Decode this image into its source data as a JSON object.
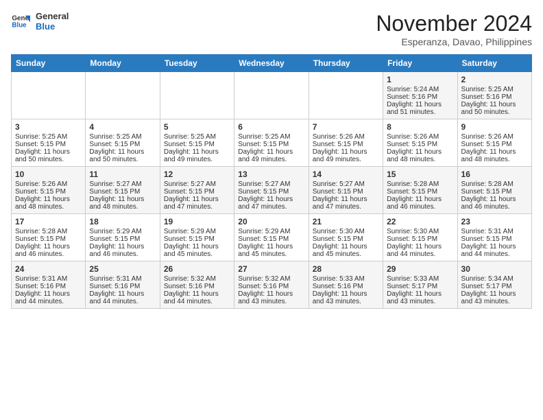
{
  "header": {
    "logo_line1": "General",
    "logo_line2": "Blue",
    "month_title": "November 2024",
    "location": "Esperanza, Davao, Philippines"
  },
  "days_of_week": [
    "Sunday",
    "Monday",
    "Tuesday",
    "Wednesday",
    "Thursday",
    "Friday",
    "Saturday"
  ],
  "weeks": [
    [
      {
        "day": "",
        "sunrise": "",
        "sunset": "",
        "daylight": ""
      },
      {
        "day": "",
        "sunrise": "",
        "sunset": "",
        "daylight": ""
      },
      {
        "day": "",
        "sunrise": "",
        "sunset": "",
        "daylight": ""
      },
      {
        "day": "",
        "sunrise": "",
        "sunset": "",
        "daylight": ""
      },
      {
        "day": "",
        "sunrise": "",
        "sunset": "",
        "daylight": ""
      },
      {
        "day": "1",
        "sunrise": "Sunrise: 5:24 AM",
        "sunset": "Sunset: 5:16 PM",
        "daylight": "Daylight: 11 hours and 51 minutes."
      },
      {
        "day": "2",
        "sunrise": "Sunrise: 5:25 AM",
        "sunset": "Sunset: 5:16 PM",
        "daylight": "Daylight: 11 hours and 50 minutes."
      }
    ],
    [
      {
        "day": "3",
        "sunrise": "Sunrise: 5:25 AM",
        "sunset": "Sunset: 5:15 PM",
        "daylight": "Daylight: 11 hours and 50 minutes."
      },
      {
        "day": "4",
        "sunrise": "Sunrise: 5:25 AM",
        "sunset": "Sunset: 5:15 PM",
        "daylight": "Daylight: 11 hours and 50 minutes."
      },
      {
        "day": "5",
        "sunrise": "Sunrise: 5:25 AM",
        "sunset": "Sunset: 5:15 PM",
        "daylight": "Daylight: 11 hours and 49 minutes."
      },
      {
        "day": "6",
        "sunrise": "Sunrise: 5:25 AM",
        "sunset": "Sunset: 5:15 PM",
        "daylight": "Daylight: 11 hours and 49 minutes."
      },
      {
        "day": "7",
        "sunrise": "Sunrise: 5:26 AM",
        "sunset": "Sunset: 5:15 PM",
        "daylight": "Daylight: 11 hours and 49 minutes."
      },
      {
        "day": "8",
        "sunrise": "Sunrise: 5:26 AM",
        "sunset": "Sunset: 5:15 PM",
        "daylight": "Daylight: 11 hours and 48 minutes."
      },
      {
        "day": "9",
        "sunrise": "Sunrise: 5:26 AM",
        "sunset": "Sunset: 5:15 PM",
        "daylight": "Daylight: 11 hours and 48 minutes."
      }
    ],
    [
      {
        "day": "10",
        "sunrise": "Sunrise: 5:26 AM",
        "sunset": "Sunset: 5:15 PM",
        "daylight": "Daylight: 11 hours and 48 minutes."
      },
      {
        "day": "11",
        "sunrise": "Sunrise: 5:27 AM",
        "sunset": "Sunset: 5:15 PM",
        "daylight": "Daylight: 11 hours and 48 minutes."
      },
      {
        "day": "12",
        "sunrise": "Sunrise: 5:27 AM",
        "sunset": "Sunset: 5:15 PM",
        "daylight": "Daylight: 11 hours and 47 minutes."
      },
      {
        "day": "13",
        "sunrise": "Sunrise: 5:27 AM",
        "sunset": "Sunset: 5:15 PM",
        "daylight": "Daylight: 11 hours and 47 minutes."
      },
      {
        "day": "14",
        "sunrise": "Sunrise: 5:27 AM",
        "sunset": "Sunset: 5:15 PM",
        "daylight": "Daylight: 11 hours and 47 minutes."
      },
      {
        "day": "15",
        "sunrise": "Sunrise: 5:28 AM",
        "sunset": "Sunset: 5:15 PM",
        "daylight": "Daylight: 11 hours and 46 minutes."
      },
      {
        "day": "16",
        "sunrise": "Sunrise: 5:28 AM",
        "sunset": "Sunset: 5:15 PM",
        "daylight": "Daylight: 11 hours and 46 minutes."
      }
    ],
    [
      {
        "day": "17",
        "sunrise": "Sunrise: 5:28 AM",
        "sunset": "Sunset: 5:15 PM",
        "daylight": "Daylight: 11 hours and 46 minutes."
      },
      {
        "day": "18",
        "sunrise": "Sunrise: 5:29 AM",
        "sunset": "Sunset: 5:15 PM",
        "daylight": "Daylight: 11 hours and 46 minutes."
      },
      {
        "day": "19",
        "sunrise": "Sunrise: 5:29 AM",
        "sunset": "Sunset: 5:15 PM",
        "daylight": "Daylight: 11 hours and 45 minutes."
      },
      {
        "day": "20",
        "sunrise": "Sunrise: 5:29 AM",
        "sunset": "Sunset: 5:15 PM",
        "daylight": "Daylight: 11 hours and 45 minutes."
      },
      {
        "day": "21",
        "sunrise": "Sunrise: 5:30 AM",
        "sunset": "Sunset: 5:15 PM",
        "daylight": "Daylight: 11 hours and 45 minutes."
      },
      {
        "day": "22",
        "sunrise": "Sunrise: 5:30 AM",
        "sunset": "Sunset: 5:15 PM",
        "daylight": "Daylight: 11 hours and 44 minutes."
      },
      {
        "day": "23",
        "sunrise": "Sunrise: 5:31 AM",
        "sunset": "Sunset: 5:15 PM",
        "daylight": "Daylight: 11 hours and 44 minutes."
      }
    ],
    [
      {
        "day": "24",
        "sunrise": "Sunrise: 5:31 AM",
        "sunset": "Sunset: 5:16 PM",
        "daylight": "Daylight: 11 hours and 44 minutes."
      },
      {
        "day": "25",
        "sunrise": "Sunrise: 5:31 AM",
        "sunset": "Sunset: 5:16 PM",
        "daylight": "Daylight: 11 hours and 44 minutes."
      },
      {
        "day": "26",
        "sunrise": "Sunrise: 5:32 AM",
        "sunset": "Sunset: 5:16 PM",
        "daylight": "Daylight: 11 hours and 44 minutes."
      },
      {
        "day": "27",
        "sunrise": "Sunrise: 5:32 AM",
        "sunset": "Sunset: 5:16 PM",
        "daylight": "Daylight: 11 hours and 43 minutes."
      },
      {
        "day": "28",
        "sunrise": "Sunrise: 5:33 AM",
        "sunset": "Sunset: 5:16 PM",
        "daylight": "Daylight: 11 hours and 43 minutes."
      },
      {
        "day": "29",
        "sunrise": "Sunrise: 5:33 AM",
        "sunset": "Sunset: 5:17 PM",
        "daylight": "Daylight: 11 hours and 43 minutes."
      },
      {
        "day": "30",
        "sunrise": "Sunrise: 5:34 AM",
        "sunset": "Sunset: 5:17 PM",
        "daylight": "Daylight: 11 hours and 43 minutes."
      }
    ]
  ]
}
